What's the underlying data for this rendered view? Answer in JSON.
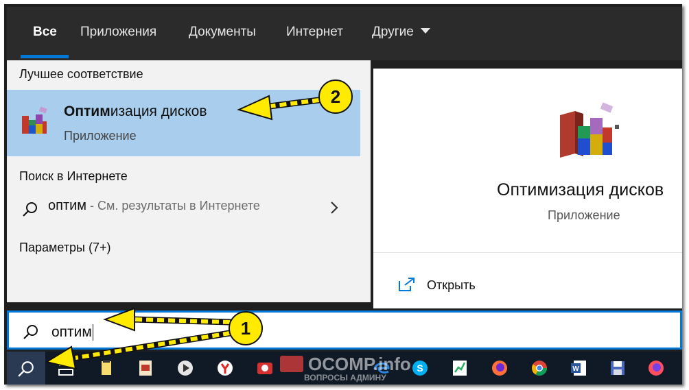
{
  "tabs": [
    {
      "label": "Все",
      "active": true
    },
    {
      "label": "Приложения"
    },
    {
      "label": "Документы"
    },
    {
      "label": "Интернет"
    },
    {
      "label": "Другие"
    }
  ],
  "best_match": {
    "heading": "Лучшее соответствие",
    "title_bold": "Оптим",
    "title_rest": "изация дисков",
    "subtitle": "Приложение"
  },
  "web_search": {
    "heading": "Поиск в Интернете",
    "query": "оптим",
    "suffix": " - См. результаты в Интернете"
  },
  "settings": {
    "heading": "Параметры (7+)"
  },
  "preview": {
    "title": "Оптимизация дисков",
    "subtitle": "Приложение",
    "open_label": "Открыть"
  },
  "search": {
    "value": "оптим"
  },
  "annotations": [
    {
      "number": "1"
    },
    {
      "number": "2"
    }
  ],
  "watermark": {
    "text": "OCOMP.info",
    "subtext": "ВОПРОСЫ АДМИНУ"
  },
  "colors": {
    "accent": "#0078d7",
    "highlight": "#a9cdec",
    "arrow": "#ffea00"
  },
  "taskbar_icons": [
    "search-icon",
    "task-view-icon",
    "sd-card-icon",
    "document-icon",
    "media-player-icon",
    "yandex-browser-icon",
    "camera-app-icon",
    "add-app-icon",
    "edge-icon",
    "skype-icon",
    "chart-icon",
    "firefox-icon",
    "chrome-icon",
    "word-icon",
    "save-icon",
    "firefox-dev-icon"
  ]
}
